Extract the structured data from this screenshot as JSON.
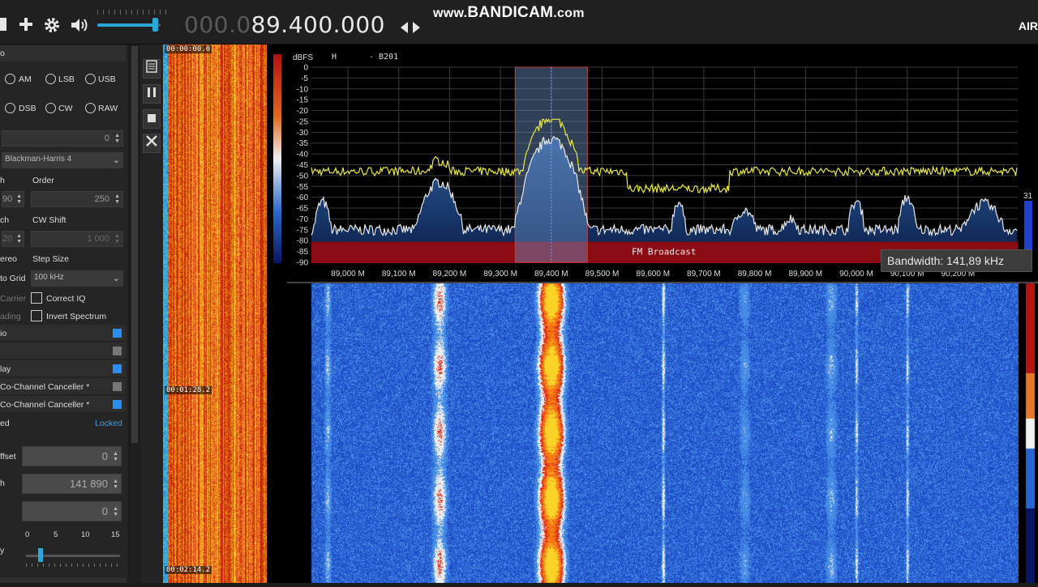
{
  "toolbar": {
    "frequency_dim": "000.0",
    "frequency_lit": "89.400.000",
    "watermark_prefix": "www.",
    "watermark_main": "BANDICAM",
    "watermark_suffix": ".com",
    "brand_partial": "AIR",
    "icons": [
      "stop-icon",
      "add-icon",
      "gear-icon",
      "speaker-icon",
      "swap-arrows-icon"
    ],
    "volume_level": 0.88
  },
  "radio_panel": {
    "header": "o",
    "modes_row1": [
      "AM",
      "LSB",
      "USB"
    ],
    "modes_row2": [
      "DSB",
      "CW",
      "RAW"
    ],
    "shift_value": "0",
    "window_type": "Blackman-Harris 4",
    "label_h": "h",
    "label_order": "Order",
    "bw_partial": "90",
    "order_value": "250",
    "label_ch": "ch",
    "label_cw_shift": "CW Shift",
    "squelch_partial": "20",
    "cw_shift_value": "1 000",
    "label_stereo": "ereo",
    "label_step_size": "Step Size",
    "label_snap": "to Grid",
    "step_size_value": "100 kHz",
    "label_carrier": "Carrier",
    "label_correct_iq": "Correct IQ",
    "label_fading": "ading",
    "label_invert": "Invert Spectrum"
  },
  "plugins": [
    {
      "label": "io",
      "state": "on"
    },
    {
      "label": "",
      "state": "off"
    },
    {
      "label": "lay",
      "state": "on"
    },
    {
      "label": "Co-Channel Canceller *",
      "state": "off"
    },
    {
      "label": "Co-Channel Canceller *",
      "state": "on"
    }
  ],
  "lock_panel": {
    "label": "ed",
    "status": "Locked",
    "offset_label": "ffset",
    "offset_value": "0",
    "bandwidth_label": "h",
    "bandwidth_value": "141 890",
    "third_value": "0",
    "slider_ticks": [
      "0",
      "5",
      "10",
      "15"
    ],
    "slider_label": "y"
  },
  "if_waterfall": {
    "timestamps": [
      "00:00:00.0",
      "00:01:28.2",
      "00:02:14.2"
    ]
  },
  "spectrum": {
    "axis_unit": "dBFS",
    "header_h": "H",
    "header_device": "- B201",
    "y_ticks": [
      "0",
      "-5",
      "-10",
      "-15",
      "-20",
      "-25",
      "-30",
      "-35",
      "-40",
      "-45",
      "-50",
      "-55",
      "-60",
      "-65",
      "-70",
      "-75",
      "-80",
      "-85",
      "-90"
    ],
    "x_ticks": [
      "89,000 M",
      "89,100 M",
      "89,200 M",
      "89,300 M",
      "89,400 M",
      "89,500 M",
      "89,600 M",
      "89,700 M",
      "89,800 M",
      "89,900 M",
      "90,000 M",
      "90,100 M",
      "90,200 M"
    ],
    "band_label": "FM Broadcast",
    "side_value": "31",
    "tooltip": "Bandwidth: 141,89 kHz",
    "colors": {
      "peak_trace": "#e8e84a",
      "live_trace": "#e8e8e8",
      "band_plan": "#8c0c14",
      "filter": "#5b86b8"
    }
  }
}
